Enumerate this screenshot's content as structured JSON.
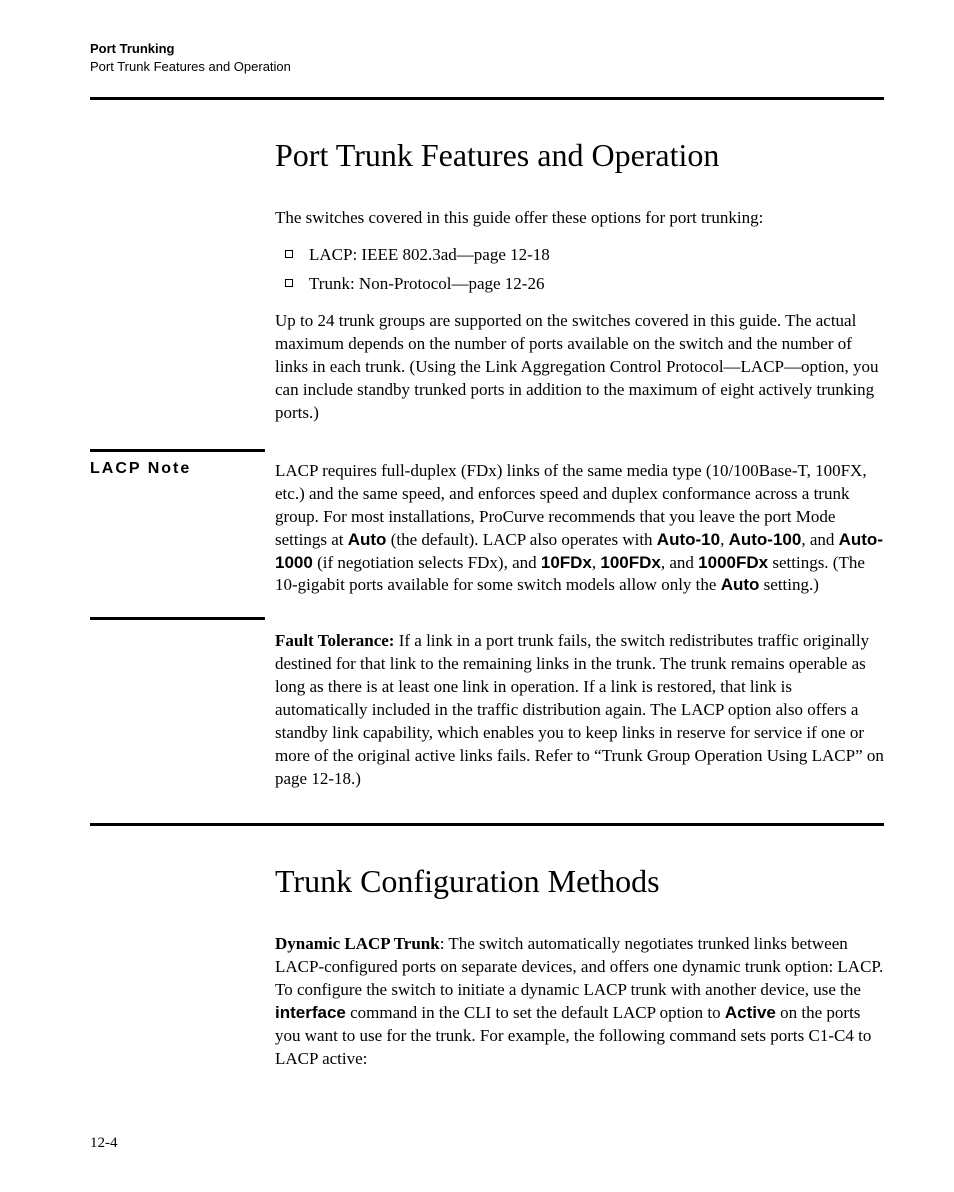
{
  "header": {
    "chapter": "Port Trunking",
    "section": "Port Trunk Features and Operation"
  },
  "section1": {
    "heading": "Port Trunk Features and Operation",
    "intro": "The switches covered in this guide offer these options for port trunking:",
    "bullets": [
      "LACP: IEEE 802.3ad—page 12-18",
      "Trunk: Non-Protocol—page 12-26"
    ],
    "para2": "Up to 24 trunk groups are supported on the switches covered in this guide. The actual maximum depends on the number of ports available on the switch and the number of links in each trunk. (Using the Link Aggregation Control Protocol—LACP—option, you can include standby trunked ports in addition to the maximum of eight actively trunking ports.)"
  },
  "lacp_note": {
    "label": "LACP Note",
    "p1a": "LACP requires full-duplex (FDx) links of the same media type (10/100Base-T, 100FX, etc.) and the same speed, and enforces speed and duplex conformance across a trunk group. For most installations, ProCurve recommends that you leave the port Mode settings at ",
    "auto": "Auto",
    "p1b": " (the default). LACP also operates with ",
    "a10": "Auto-10",
    "c1": ", ",
    "a100": "Auto-100",
    "c2": ", and ",
    "a1000": "Auto-1000",
    "p1c": " (if negotiation selects FDx), and ",
    "f10": "10FDx",
    "c3": ", ",
    "f100": "100FDx",
    "c4": ", and ",
    "f1000": "1000FDx",
    "p1d": " settings. (The 10-gigabit ports available for some switch models allow only the ",
    "auto2": "Auto",
    "p1e": " setting.)"
  },
  "fault": {
    "label": "Fault Tolerance:   ",
    "body": "If a link in a port trunk fails, the switch redistributes traffic originally destined for that link to the remaining links in the trunk. The trunk remains operable as long as there is at least one link in operation. If a link is restored, that link is automatically included in the traffic distribution again. The LACP option also offers a standby link capability, which enables you to keep links in reserve for service if one or more of the original active links fails. Refer to “Trunk Group Operation Using LACP” on page 12-18.)"
  },
  "section2": {
    "heading": "Trunk Configuration Methods",
    "dyn_label": "Dynamic LACP Trunk",
    "p1a": ": The switch automatically negotiates trunked links between LACP-configured ports on separate devices, and offers one dynamic trunk option: LACP. To configure the switch to initiate a dynamic LACP trunk with another device, use the ",
    "iface": "interface",
    "p1b": " command in the CLI to set the default LACP option to ",
    "active": "Active",
    "p1c": " on the ports you want to use for the trunk. For example, the following command sets ports C1-C4 to LACP active:"
  },
  "pagenum": "12-4"
}
